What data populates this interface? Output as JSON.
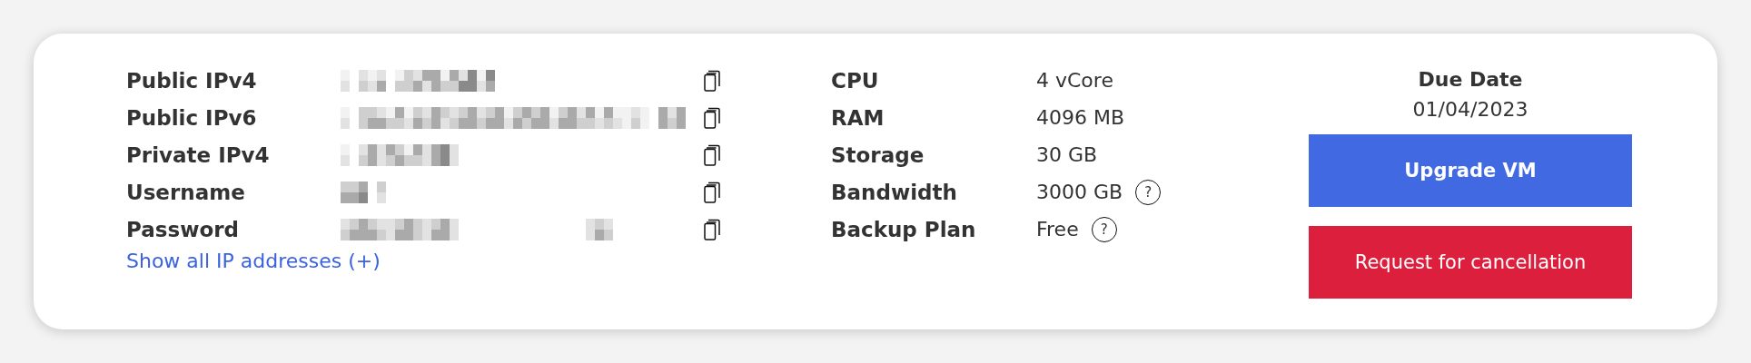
{
  "access": {
    "rows": [
      {
        "label": "Public IPv4",
        "value": {
          "kind": "redacted"
        }
      },
      {
        "label": "Public IPv6",
        "value": {
          "kind": "redacted"
        }
      },
      {
        "label": "Private IPv4",
        "value": {
          "kind": "redacted"
        }
      },
      {
        "label": "Username",
        "value": {
          "kind": "redacted"
        }
      },
      {
        "label": "Password",
        "value": {
          "kind": "redacted"
        }
      }
    ],
    "link": "Show all IP addresses (+)"
  },
  "specs": [
    {
      "label": "CPU",
      "value": "4 vCore"
    },
    {
      "label": "RAM",
      "value": "4096 MB"
    },
    {
      "label": "Storage",
      "value": "30 GB"
    },
    {
      "label": "Bandwidth",
      "value": "3000 GB",
      "help_text": "?"
    },
    {
      "label": "Backup Plan",
      "value": "Free",
      "help_text": "?"
    }
  ],
  "due": {
    "label": "Due Date",
    "date": "01/04/2023"
  },
  "buttons": [
    {
      "label": "Upgrade VM",
      "kind": "primary"
    },
    {
      "label": "Request for cancellation",
      "kind": "danger"
    }
  ]
}
